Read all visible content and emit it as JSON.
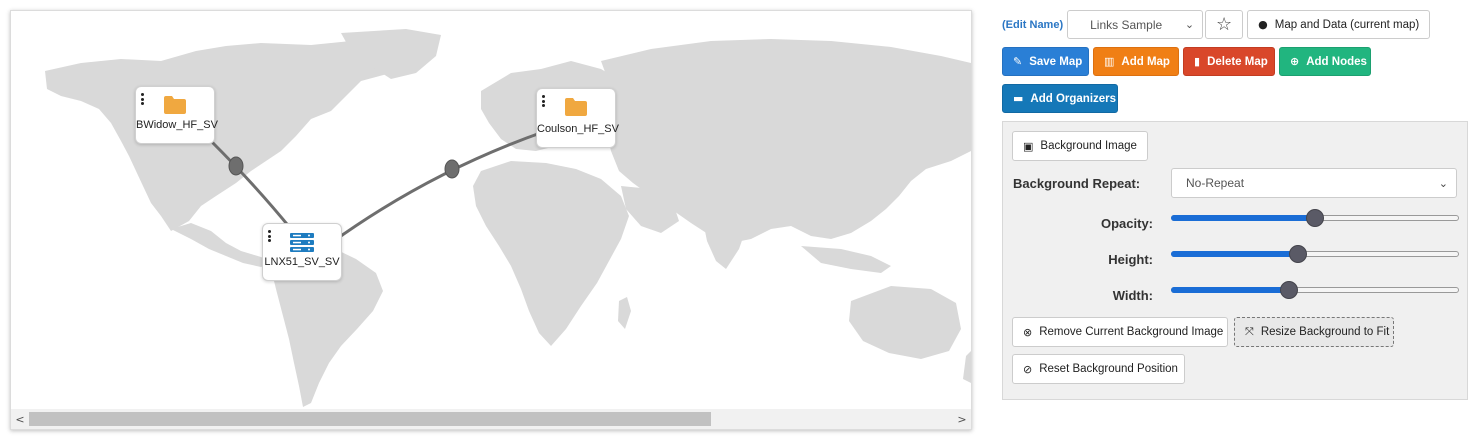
{
  "map": {
    "nodes": [
      {
        "label": "BWidow_HF_SV",
        "icon": "folder-icon",
        "color": "#f0a840"
      },
      {
        "label": "Coulson_HF_SV",
        "icon": "folder-icon",
        "color": "#f0a840"
      },
      {
        "label": "LNX51_SV_SV",
        "icon": "server-icon",
        "color": "#1e7cc0"
      }
    ],
    "land_color": "#d9d9d9",
    "link_color": "#6e6e6e"
  },
  "scrollbar": {
    "left_arrow": "<",
    "right_arrow": ">"
  },
  "header": {
    "edit_name": "(Edit Name)",
    "map_select": "Links Sample",
    "favorite_icon": "star-icon",
    "map_data_button": "Map and Data (current map)"
  },
  "toolbar": {
    "save_map": "Save Map",
    "add_map": "Add Map",
    "delete_map": "Delete Map",
    "add_nodes": "Add Nodes",
    "add_organizers": "Add Organizers"
  },
  "background": {
    "image_button": "Background Image",
    "repeat_label": "Background Repeat:",
    "repeat_value": "No-Repeat",
    "opacity_label": "Opacity:",
    "opacity_value": 0.5,
    "height_label": "Height:",
    "height_value": 0.44,
    "width_label": "Width:",
    "width_value": 0.41,
    "remove_button": "Remove Current Background Image",
    "resize_button": "Resize Background to Fit",
    "reset_button": "Reset Background Position"
  },
  "colors": {
    "save": "#2a7fd6",
    "add_map": "#f07f15",
    "delete": "#d9472a",
    "add_nodes": "#21b57f",
    "add_organizers": "#1578b8",
    "slider_fill": "#1a6dd6"
  }
}
